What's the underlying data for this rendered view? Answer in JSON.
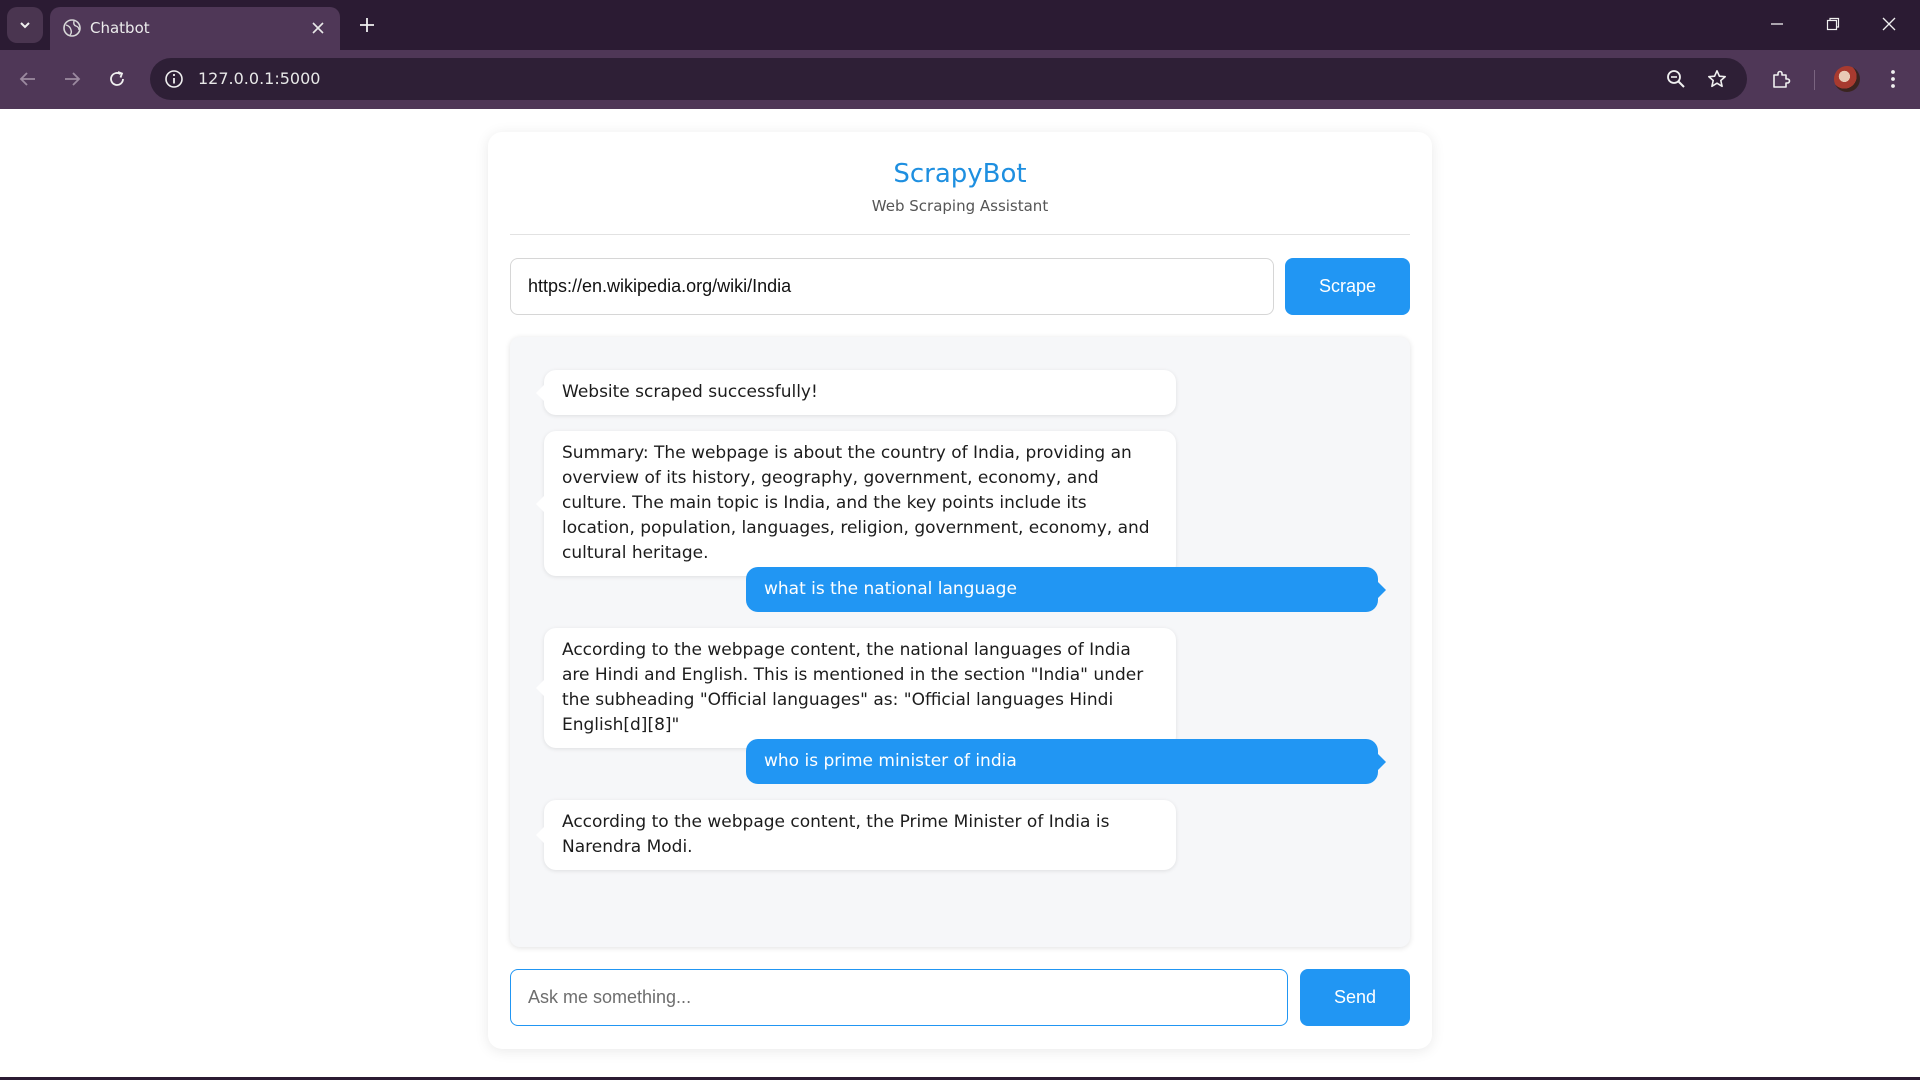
{
  "browser": {
    "tab_title": "Chatbot",
    "url": "127.0.0.1:5000",
    "icons": {
      "tab_search": "chevron-down-icon",
      "favicon": "globe-icon",
      "tab_close": "close-icon",
      "new_tab": "plus-icon",
      "back": "arrow-left-icon",
      "forward": "arrow-right-icon",
      "reload": "reload-icon",
      "site_info": "info-icon",
      "zoom": "zoom-out-icon",
      "bookmark": "star-icon",
      "extensions": "puzzle-icon",
      "menu": "kebab-menu-icon"
    },
    "colors": {
      "frame": "#2b1b33",
      "toolbar": "#4f3757"
    }
  },
  "app": {
    "title": "ScrapyBot",
    "subtitle": "Web Scraping Assistant",
    "accent_color": "#2196f3"
  },
  "scrape": {
    "url_value": "https://en.wikipedia.org/wiki/India",
    "button_label": "Scrape"
  },
  "messages": [
    {
      "role": "bot",
      "text": "Website scraped successfully!"
    },
    {
      "role": "bot",
      "text": "Summary: The webpage is about the country of India, providing an overview of its history, geography, government, economy, and culture. The main topic is India, and the key points include its location, population, languages, religion, government, economy, and cultural heritage."
    },
    {
      "role": "user",
      "text": "what is the national language"
    },
    {
      "role": "bot",
      "text": "According to the webpage content, the national languages of India are Hindi and English. This is mentioned in the section \"India\" under the subheading \"Official languages\" as: \"Official languages Hindi English[d][8]\""
    },
    {
      "role": "user",
      "text": "who is prime minister of india"
    },
    {
      "role": "bot",
      "text": "According to the webpage content, the Prime Minister of India is Narendra Modi."
    }
  ],
  "composer": {
    "placeholder": "Ask me something...",
    "value": "",
    "send_label": "Send"
  }
}
